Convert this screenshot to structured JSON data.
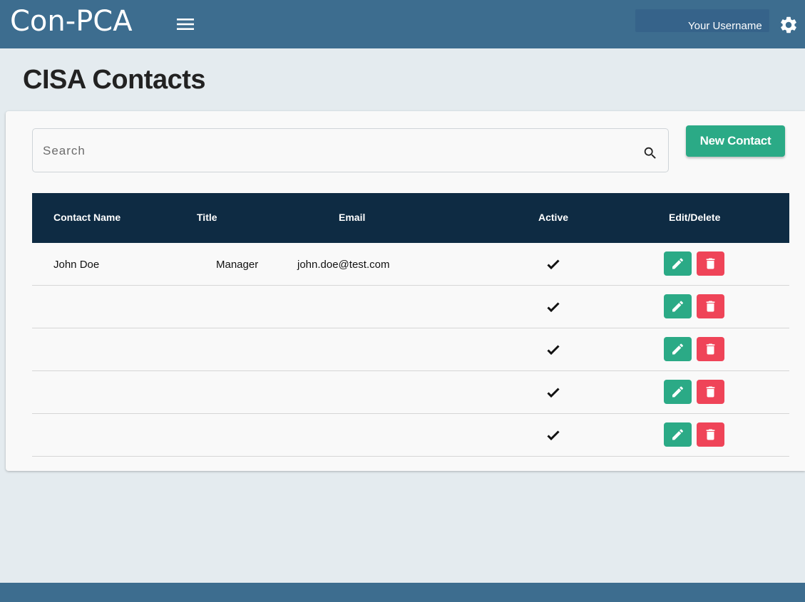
{
  "header": {
    "logo_text": "Con-PCA",
    "username": "Your Username"
  },
  "page": {
    "title": "CISA Contacts"
  },
  "toolbar": {
    "search_placeholder": "Search",
    "search_value": "",
    "new_contact_label": "New Contact"
  },
  "table": {
    "columns": [
      "Contact Name",
      "Title",
      "Email",
      "Active",
      "Edit/Delete"
    ],
    "rows": [
      {
        "name": "John Doe",
        "title": "Manager",
        "email": "john.doe@test.com",
        "active": true
      },
      {
        "name": "",
        "title": "",
        "email": "",
        "active": true
      },
      {
        "name": "",
        "title": "",
        "email": "",
        "active": true
      },
      {
        "name": "",
        "title": "",
        "email": "",
        "active": true
      },
      {
        "name": "",
        "title": "",
        "email": "",
        "active": true
      }
    ]
  },
  "colors": {
    "header_bg": "#3d6d8f",
    "table_header_bg": "#0e2b43",
    "accent_green": "#2baa86",
    "danger_red": "#ef4458",
    "logo_accent": "#e8b820"
  },
  "icons": {
    "menu": "hamburger-icon",
    "settings": "gear-icon",
    "search": "search-icon",
    "active": "check-icon",
    "edit": "pencil-icon",
    "delete": "trash-icon"
  }
}
